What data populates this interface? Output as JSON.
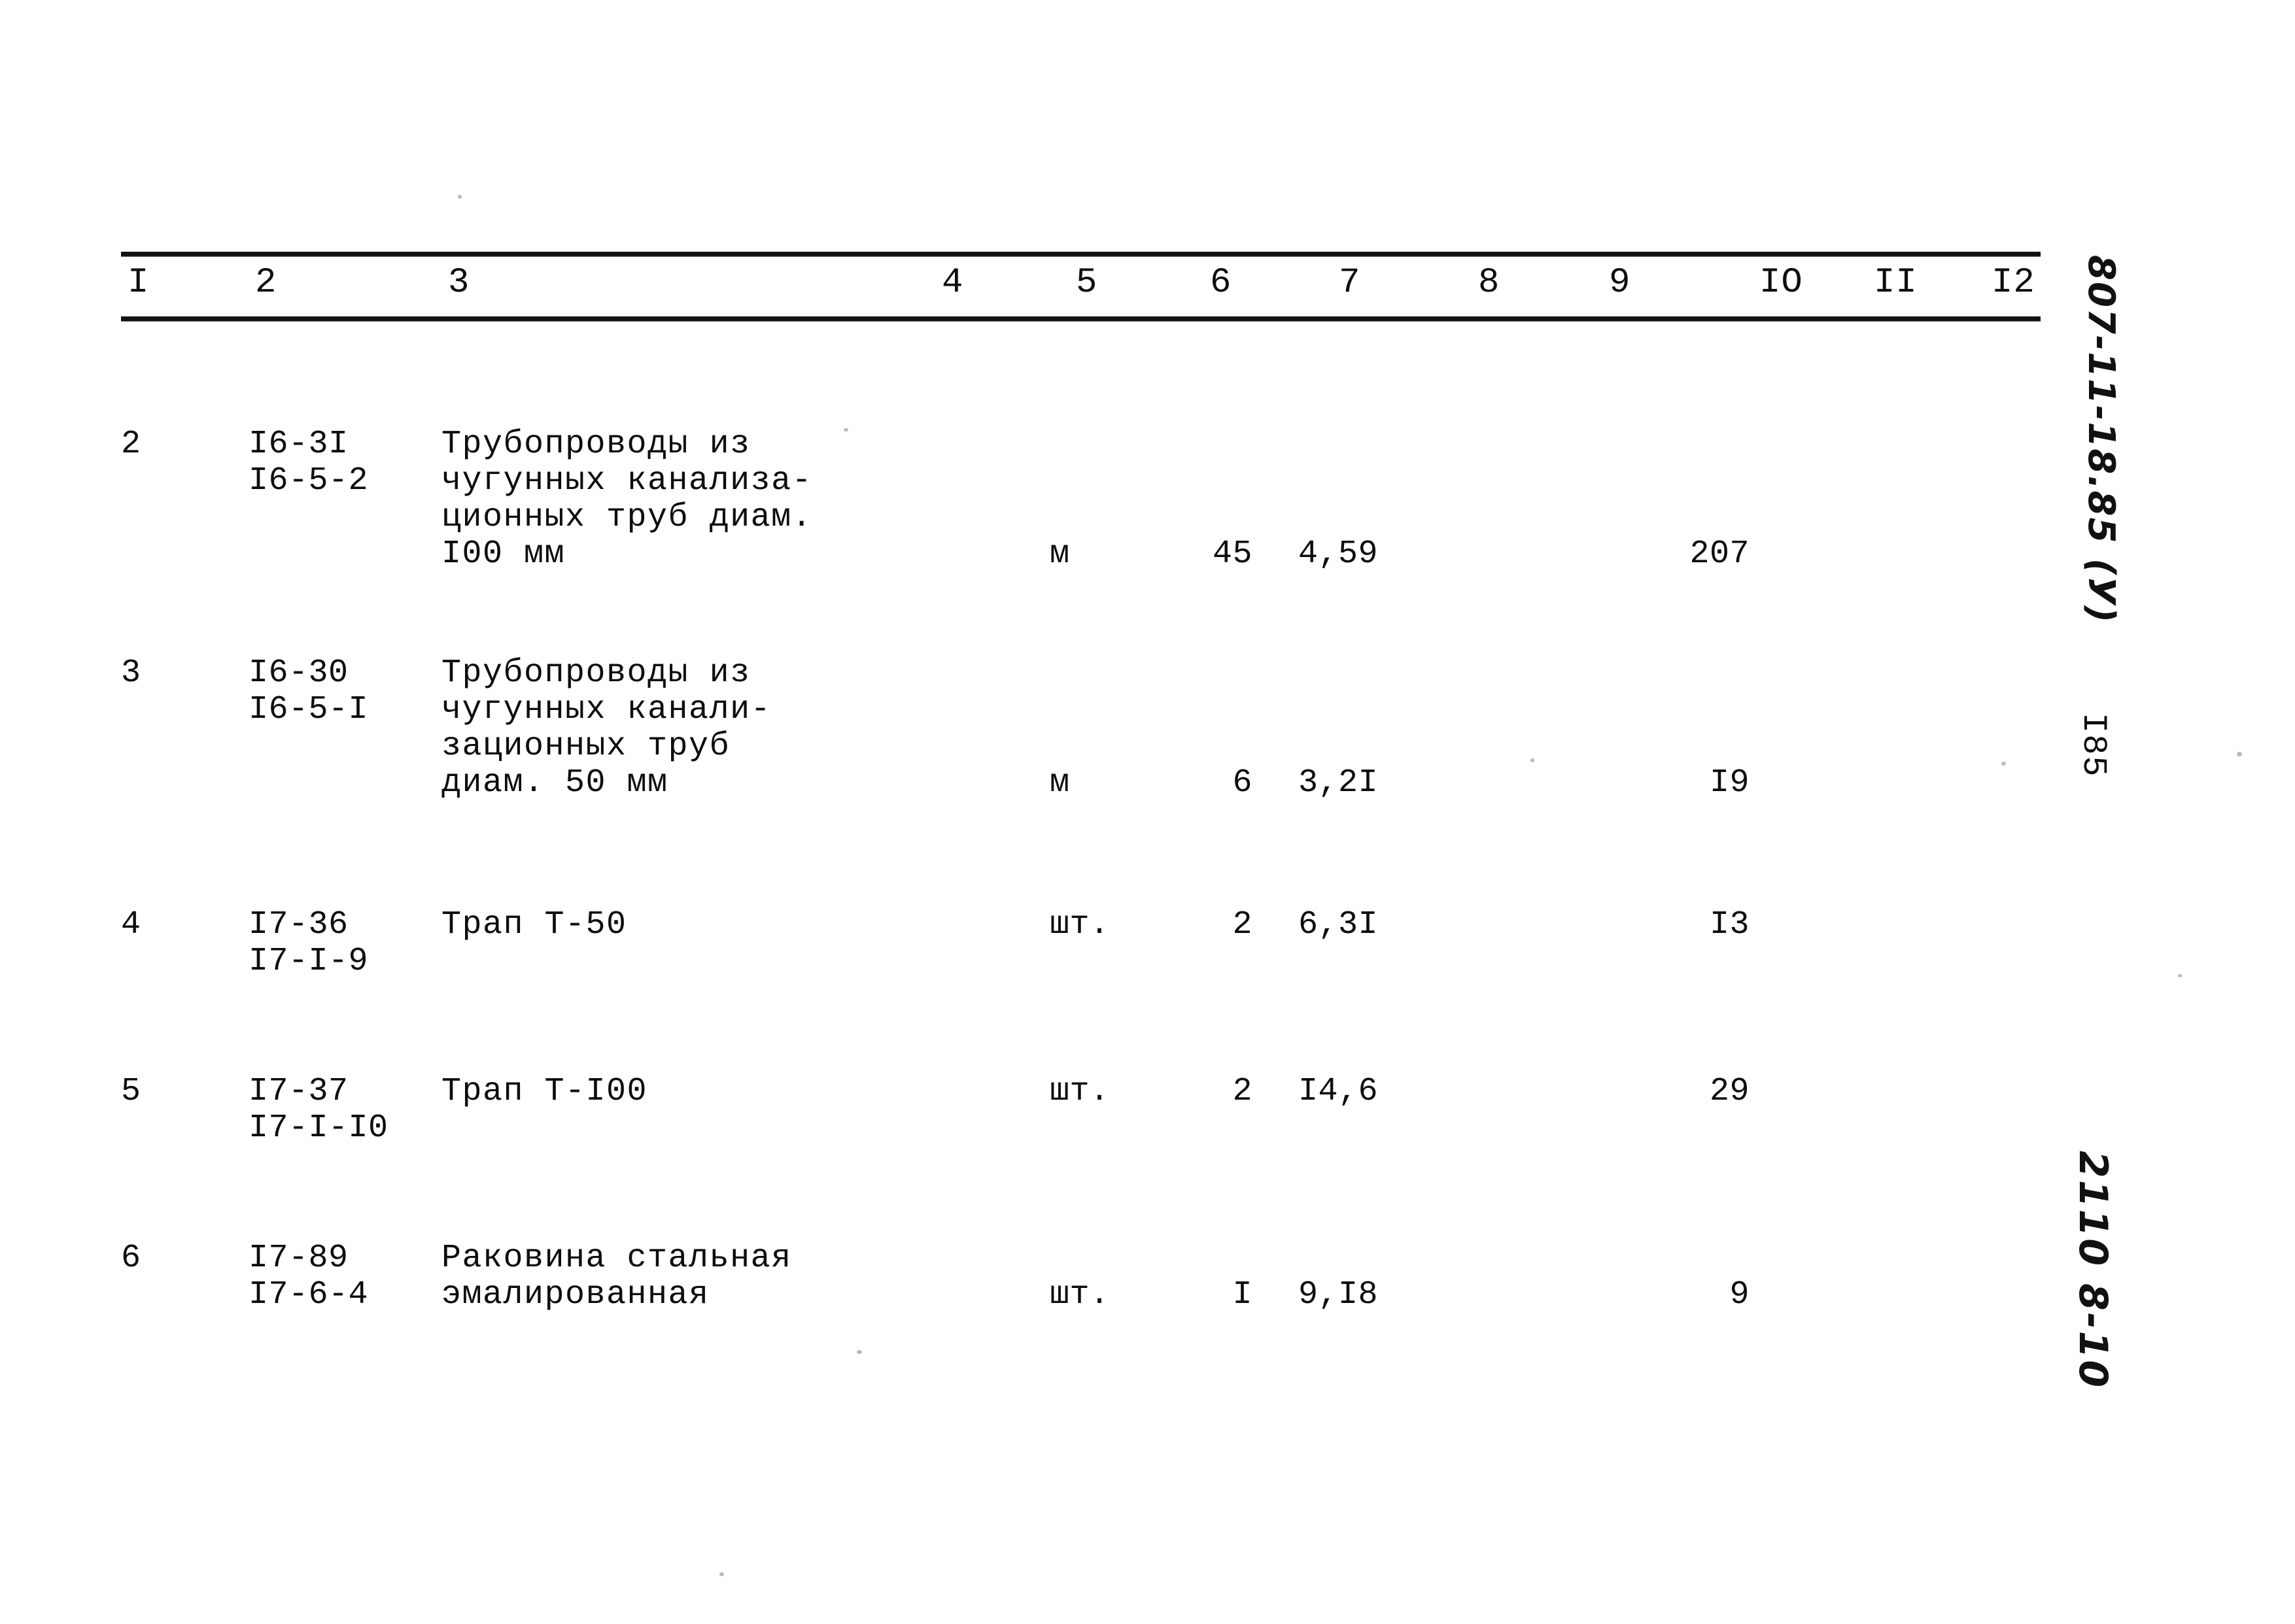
{
  "document": {
    "column_headers": [
      "I",
      "2",
      "3",
      "4",
      "5",
      "6",
      "7",
      "8",
      "9",
      "IO",
      "II",
      "I2"
    ],
    "rows": [
      {
        "num": "2",
        "code_line1": "I6-3I",
        "code_line2": "I6-5-2",
        "desc_line1": "Трубопроводы из",
        "desc_line2": "чугунных канализа-",
        "desc_line3": "ционных труб диам.",
        "desc_line4": "I00 мм",
        "unit": "м",
        "qty": "45",
        "price": "4,59",
        "total": "207"
      },
      {
        "num": "3",
        "code_line1": "I6-30",
        "code_line2": "I6-5-I",
        "desc_line1": "Трубопроводы из",
        "desc_line2": "чугунных канали-",
        "desc_line3": "зационных труб",
        "desc_line4": "диам. 50 мм",
        "unit": "м",
        "qty": "6",
        "price": "3,2I",
        "total": "I9"
      },
      {
        "num": "4",
        "code_line1": "I7-36",
        "code_line2": "I7-I-9",
        "desc_line1": "Трап Т-50",
        "desc_line2": "",
        "desc_line3": "",
        "desc_line4": "",
        "unit": "шт.",
        "qty": "2",
        "price": "6,3I",
        "total": "I3"
      },
      {
        "num": "5",
        "code_line1": "I7-37",
        "code_line2": "I7-I-I0",
        "desc_line1": "Трап Т-I00",
        "desc_line2": "",
        "desc_line3": "",
        "desc_line4": "",
        "unit": "шт.",
        "qty": "2",
        "price": "I4,6",
        "total": "29"
      },
      {
        "num": "6",
        "code_line1": "I7-89",
        "code_line2": "I7-6-4",
        "desc_line1": "Раковина стальная",
        "desc_line2": "эмалированная",
        "desc_line3": "",
        "desc_line4": "",
        "unit": "шт.",
        "qty": "I",
        "price": "9,I8",
        "total": "9"
      }
    ]
  },
  "margin": {
    "doc_code": "807-11-18.85 (У)",
    "page_number": "I85",
    "archive_mark": "2110 8-10"
  }
}
